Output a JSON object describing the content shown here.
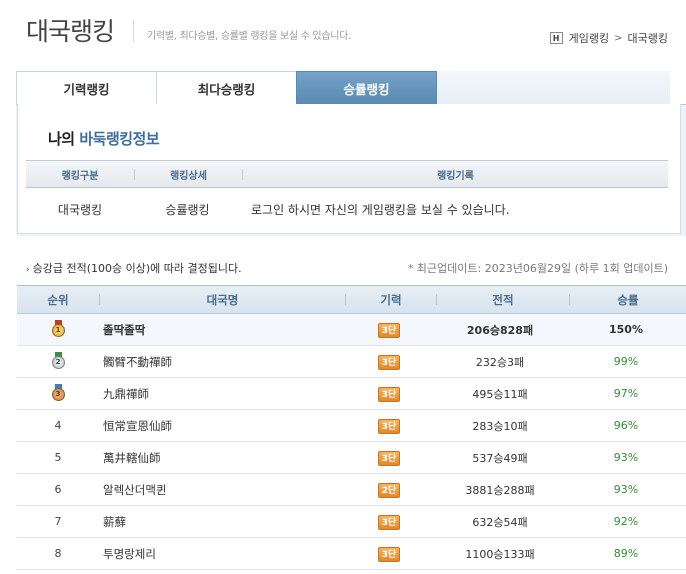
{
  "header": {
    "title": "대국랭킹",
    "description": "기력별, 최다승별, 승률별 랭킹을 보실 수 있습니다.",
    "home_icon": "H",
    "breadcrumb": [
      "게임랭킹",
      "대국랭킹"
    ]
  },
  "tabs": [
    {
      "label": "기력랭킹",
      "active": false
    },
    {
      "label": "최다승랭킹",
      "active": false
    },
    {
      "label": "승률랭킹",
      "active": true
    }
  ],
  "my_ranking": {
    "title_prefix": "나의",
    "title_highlight": "바둑랭킹정보",
    "columns": [
      "랭킹구분",
      "랭킹상세",
      "랭킹기록"
    ],
    "row": [
      "대국랭킹",
      "승률랭킹",
      "로그인 하시면 자신의 게임랭킹을 보실 수 있습니다."
    ]
  },
  "info": {
    "left": "승강급 전적(100승 이상)에 따라 결정됩니다.",
    "right": "* 최근업데이트: 2023년06월29일 (하루 1회 업데이트)"
  },
  "ranking": {
    "columns": [
      "순위",
      "대국명",
      "기력",
      "전적",
      "승률"
    ],
    "rows": [
      {
        "rank": "1",
        "medal": "gold",
        "name": "졸딱졸딱",
        "grade": "3단",
        "record": "206승828패",
        "rate": "150%"
      },
      {
        "rank": "2",
        "medal": "silver",
        "name": "髑臂不動禪師",
        "grade": "3단",
        "record": "232승3패",
        "rate": "99%"
      },
      {
        "rank": "3",
        "medal": "bronze",
        "name": "九鼎禪師",
        "grade": "3단",
        "record": "495승11패",
        "rate": "97%"
      },
      {
        "rank": "4",
        "medal": "",
        "name": "恒常宣恩仙師",
        "grade": "3단",
        "record": "283승10패",
        "rate": "96%"
      },
      {
        "rank": "5",
        "medal": "",
        "name": "萬井轄仙師",
        "grade": "3단",
        "record": "537승49패",
        "rate": "93%"
      },
      {
        "rank": "6",
        "medal": "",
        "name": "알렉산더맥퀸",
        "grade": "2단",
        "record": "3881승288패",
        "rate": "93%"
      },
      {
        "rank": "7",
        "medal": "",
        "name": "薪蘚",
        "grade": "3단",
        "record": "632승54패",
        "rate": "92%"
      },
      {
        "rank": "8",
        "medal": "",
        "name": "투명랑제리",
        "grade": "3단",
        "record": "1100승133패",
        "rate": "89%"
      }
    ]
  },
  "colors": {
    "active_tab": "#5a89b1",
    "header_text": "#4a6b8a",
    "rate_green": "#3a8a3a",
    "grade_badge": "#e08a2a"
  }
}
